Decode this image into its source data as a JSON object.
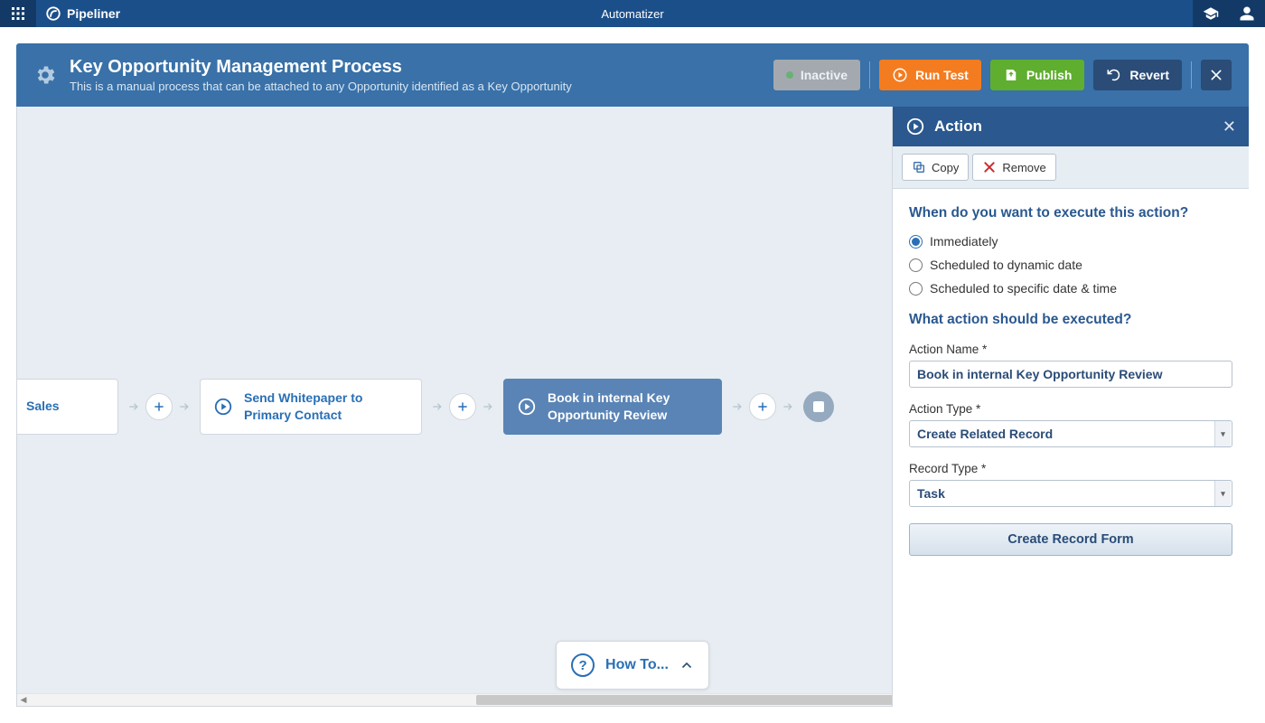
{
  "topbar": {
    "brand": "Pipeliner",
    "center": "Automatizer"
  },
  "editor": {
    "title": "Key Opportunity Management Process",
    "subtitle": "This is a manual process that can be attached to any Opportunity identified as a Key Opportunity",
    "inactive_label": "Inactive",
    "run_test_label": "Run Test",
    "publish_label": "Publish",
    "revert_label": "Revert"
  },
  "flow": {
    "node0": "Sales",
    "node1": "Send Whitepaper to Primary Contact",
    "node2": "Book in internal Key Opportunity Review"
  },
  "howto": {
    "label": "How To..."
  },
  "panel": {
    "header": "Action",
    "copy_label": "Copy",
    "remove_label": "Remove",
    "q1": "When do you want to execute this action?",
    "opt_immediately": "Immediately",
    "opt_dynamic": "Scheduled to dynamic date",
    "opt_specific": "Scheduled to specific date & time",
    "q2": "What action should be executed?",
    "action_name_label": "Action Name *",
    "action_name_value": "Book in internal Key Opportunity Review",
    "action_type_label": "Action Type *",
    "action_type_value": "Create Related Record",
    "record_type_label": "Record Type *",
    "record_type_value": "Task",
    "create_form_label": "Create Record Form"
  }
}
